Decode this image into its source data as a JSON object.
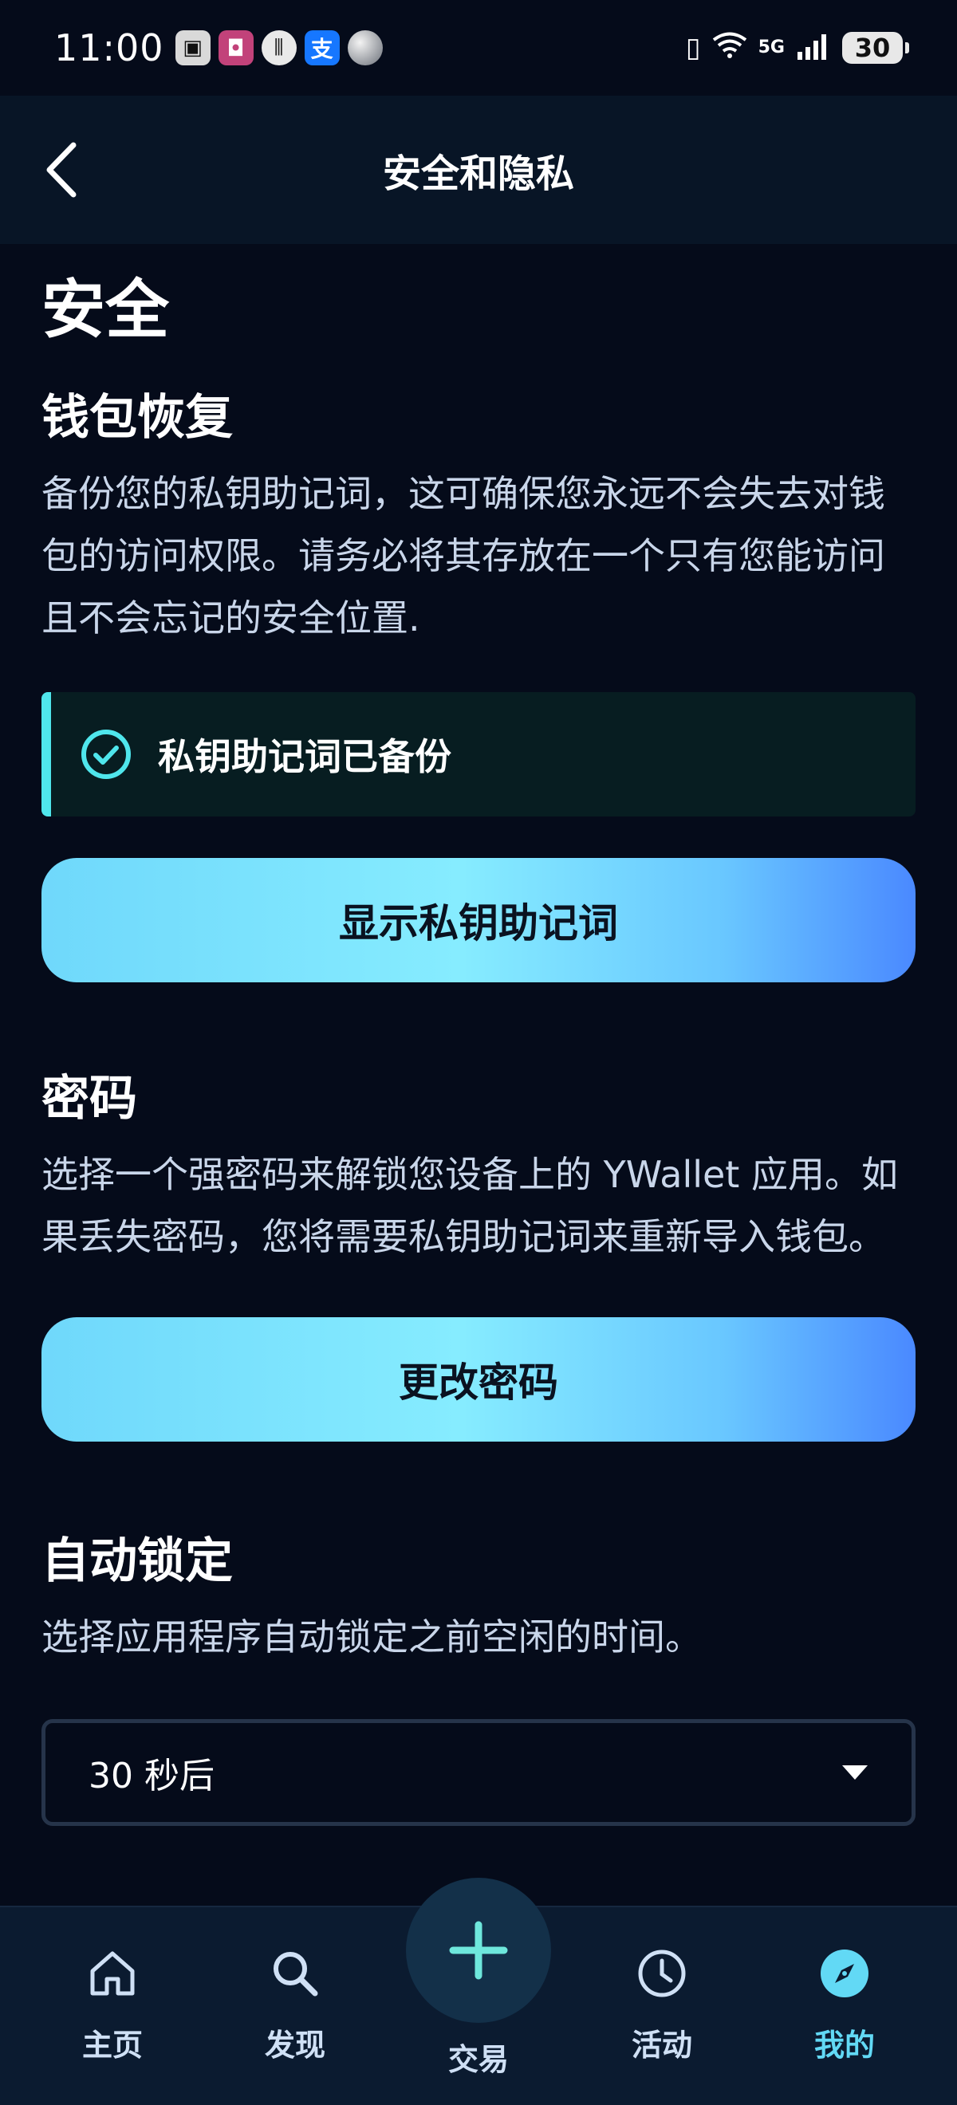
{
  "status_bar": {
    "time": "11:00",
    "network": "5G",
    "battery": "30"
  },
  "header": {
    "title": "安全和隐私"
  },
  "security": {
    "heading": "安全",
    "recovery": {
      "title": "钱包恢复",
      "description": "备份您的私钥助记词，这可确保您永远不会失去对钱包的访问权限。请务必将其存放在一个只有您能访问且不会忘记的安全位置.",
      "status_text": "私钥助记词已备份",
      "button_label": "显示私钥助记词"
    },
    "password": {
      "title": "密码",
      "description": "选择一个强密码来解锁您设备上的 YWallet 应用。如果丢失密码，您将需要私钥助记词来重新导入钱包。",
      "button_label": "更改密码"
    },
    "autolock": {
      "title": "自动锁定",
      "description": "选择应用程序自动锁定之前空闲的时间。",
      "selected_value": "30 秒后"
    }
  },
  "bottom_nav": {
    "items": [
      {
        "label": "主页",
        "icon": "home-icon"
      },
      {
        "label": "发现",
        "icon": "search-icon"
      },
      {
        "label": "交易",
        "icon": "plus-icon"
      },
      {
        "label": "活动",
        "icon": "clock-icon"
      },
      {
        "label": "我的",
        "icon": "compass-icon"
      }
    ],
    "active_index": 4
  },
  "colors": {
    "background": "#050b1a",
    "accent": "#62d9f5",
    "success": "#4fe6ec"
  }
}
